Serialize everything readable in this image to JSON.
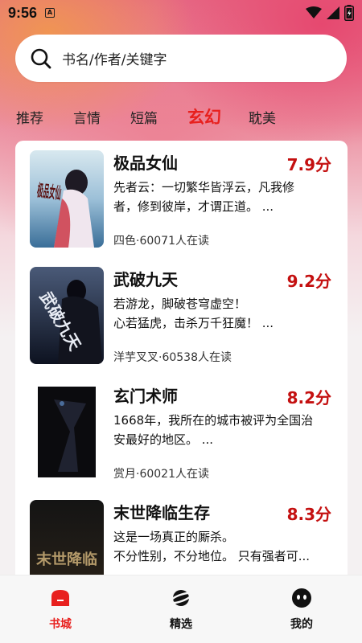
{
  "status_bar": {
    "time": "9:56",
    "notification_glyph": "A",
    "icons": [
      "wifi-icon",
      "signal-icon",
      "battery-icon"
    ]
  },
  "search": {
    "placeholder": "书名/作者/关键字",
    "icon": "search-icon"
  },
  "tabs": [
    {
      "label": "推荐",
      "active": false
    },
    {
      "label": "言情",
      "active": false
    },
    {
      "label": "短篇",
      "active": false
    },
    {
      "label": "玄幻",
      "active": true
    },
    {
      "label": "耽美",
      "active": false
    }
  ],
  "books": [
    {
      "title": "极品女仙",
      "score": "7.9分",
      "desc_lines": [
        "先者云：一切繁华皆浮云，凡我修",
        "者，修到彼岸，才谓正道。 ..."
      ],
      "meta": "四色·60071人在读",
      "cover_text": "极品女仙"
    },
    {
      "title": "武破九天",
      "score": "9.2分",
      "desc_lines": [
        "若游龙，脚破苍穹虚空！",
        "心若猛虎，击杀万千狂魔！ ..."
      ],
      "meta": "洋芋叉叉·60538人在读",
      "cover_text": "武破九天"
    },
    {
      "title": "玄门术师",
      "score": "8.2分",
      "desc_lines": [
        "1668年，我所在的城市被评为全国治",
        "安最好的地区。 ..."
      ],
      "meta": "赏月·60021人在读",
      "cover_text": ""
    },
    {
      "title": "末世降临生存",
      "score": "8.3分",
      "desc_lines": [
        "这是一场真正的厮杀。",
        "不分性别，不分地位。 只有强者可..."
      ],
      "meta": "",
      "cover_text": "末世降临"
    }
  ],
  "bottom_nav": [
    {
      "label": "书城",
      "icon": "bookstore-icon",
      "active": true
    },
    {
      "label": "精选",
      "icon": "planet-icon",
      "active": false
    },
    {
      "label": "我的",
      "icon": "profile-face-icon",
      "active": false
    }
  ],
  "colors": {
    "accent": "#e8201e",
    "score": "#c41010",
    "text": "#111111"
  }
}
